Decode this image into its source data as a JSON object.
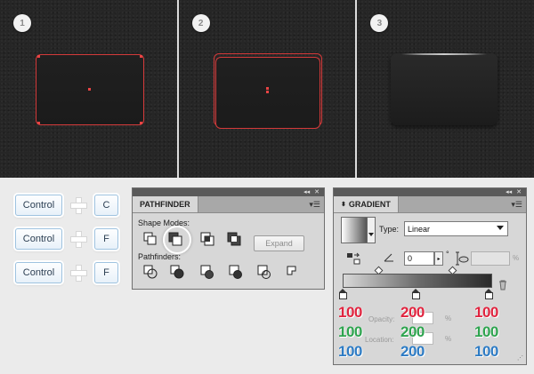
{
  "steps": [
    {
      "number": "1"
    },
    {
      "number": "2"
    },
    {
      "number": "3"
    }
  ],
  "shortcuts": [
    {
      "modifier": "Control",
      "key": "C"
    },
    {
      "modifier": "Control",
      "key": "F"
    },
    {
      "modifier": "Control",
      "key": "F"
    }
  ],
  "pathfinder": {
    "title": "PATHFINDER",
    "shape_modes_label": "Shape Modes:",
    "pathfinders_label": "Pathfinders:",
    "expand_label": "Expand",
    "shape_mode_icons": [
      "unite-icon",
      "minus-front-icon",
      "intersect-icon",
      "exclude-icon"
    ],
    "pathfinder_icons": [
      "divide-icon",
      "trim-icon",
      "merge-icon",
      "crop-icon",
      "outline-icon",
      "minus-back-icon"
    ]
  },
  "gradient": {
    "title": "GRADIENT",
    "type_label": "Type:",
    "type_value": "Linear",
    "angle_value": "0",
    "degree_symbol": "°",
    "aspect_unit": "%",
    "opacity_label": "Opacity:",
    "location_label": "Location:",
    "percent": "%",
    "rgb_rows": [
      {
        "color": "red",
        "values": [
          "100",
          "200",
          "100"
        ]
      },
      {
        "color": "green",
        "values": [
          "100",
          "200",
          "100"
        ]
      },
      {
        "color": "blue",
        "values": [
          "100",
          "200",
          "100"
        ]
      }
    ],
    "colors": {
      "red": "#e0243f",
      "green": "#2ea44f",
      "blue": "#2d7bc4"
    }
  }
}
